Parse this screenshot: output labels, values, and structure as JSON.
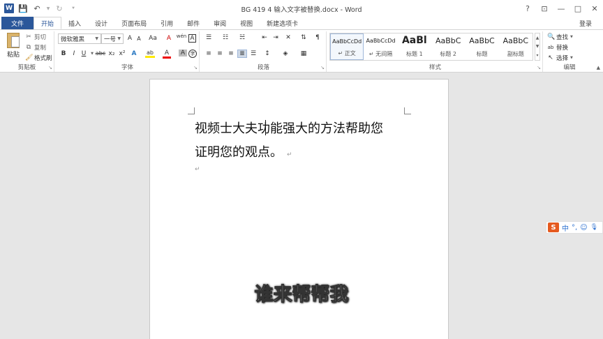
{
  "titlebar": {
    "app_badge": "W",
    "title": "BG 419 4 输入文字被替换.docx - Word",
    "help": "?",
    "restore_ribbon": "⊡",
    "minimize": "—",
    "maximize": "□",
    "close": "✕"
  },
  "tabs": {
    "file": "文件",
    "items": [
      "开始",
      "插入",
      "设计",
      "页面布局",
      "引用",
      "邮件",
      "审阅",
      "视图",
      "新建选项卡"
    ],
    "active": "开始",
    "login": "登录"
  },
  "clipboard": {
    "paste": "粘贴",
    "cut": "剪切",
    "copy": "复制",
    "format_painter": "格式刷",
    "label": "剪贴板"
  },
  "font": {
    "name": "微软雅黑",
    "size": "一号",
    "grow": "A",
    "shrink": "A",
    "change_case": "Aa",
    "clear_format": "A",
    "wen": "wén",
    "char_border": "A",
    "bold": "B",
    "italic": "I",
    "underline": "U",
    "strike": "abc",
    "subscript": "x₂",
    "superscript": "x²",
    "effects": "A",
    "highlight": "ab",
    "font_color": "A",
    "shade": "A",
    "circled": "字",
    "label": "字体"
  },
  "paragraph": {
    "label": "段落"
  },
  "styles": {
    "items": [
      {
        "sample": "AaBbCcDd",
        "name": "↵ 正文"
      },
      {
        "sample": "AaBbCcDd",
        "name": "↵ 无间隔"
      },
      {
        "sample": "AaBl",
        "name": "标题 1"
      },
      {
        "sample": "AaBbC",
        "name": "标题 2"
      },
      {
        "sample": "AaBbC",
        "name": "标题"
      },
      {
        "sample": "AaBbC",
        "name": "副标题"
      }
    ],
    "label": "样式"
  },
  "editing": {
    "find": "查找",
    "replace": "替换",
    "select": "选择",
    "label": "编辑"
  },
  "document": {
    "line1": "视频士大夫功能强大的方法帮助您",
    "line2": "证明您的观点。",
    "para_mark": "↵"
  },
  "overlay": {
    "subtitle": "谁来帮帮我"
  },
  "ime": {
    "logo": "S",
    "mode": "中",
    "punct": "°,",
    "emoji": "☺",
    "mic": "🎙"
  }
}
